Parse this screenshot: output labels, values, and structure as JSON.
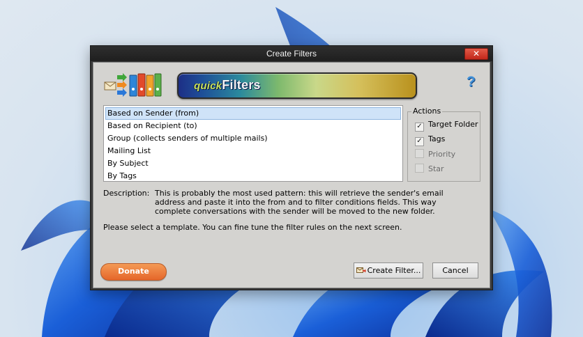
{
  "window": {
    "title": "Create Filters",
    "close_glyph": "✕"
  },
  "header": {
    "logo_icon": "quickfilters-logo-icon",
    "banner_prefix": "quick",
    "banner_word": "Filters",
    "help_glyph": "?"
  },
  "templates": {
    "items": [
      {
        "label": "Based on Sender (from)",
        "selected": true
      },
      {
        "label": "Based on Recipient (to)"
      },
      {
        "label": "Group (collects senders of multiple mails)"
      },
      {
        "label": "Mailing List"
      },
      {
        "label": "By Subject"
      },
      {
        "label": "By Tags"
      }
    ]
  },
  "actions": {
    "legend": "Actions",
    "options": [
      {
        "label": "Target Folder",
        "checked": true,
        "enabled": true
      },
      {
        "label": "Tags",
        "checked": true,
        "enabled": true
      },
      {
        "label": "Priority",
        "checked": false,
        "enabled": false
      },
      {
        "label": "Star",
        "checked": false,
        "enabled": false
      }
    ]
  },
  "description": {
    "label": "Description:",
    "text": "This is probably the most used pattern: this will retrieve the sender's email address and paste it into the from and to filter conditions fields. This way complete conversations with the sender will be moved to the new folder."
  },
  "hint": "Please select a template. You can fine tune the filter rules on the next screen.",
  "buttons": {
    "donate": "Donate",
    "create": "Create Filter...",
    "cancel": "Cancel"
  },
  "colors": {
    "accent": "#e5662a",
    "titlebar": "#1f1f1f",
    "selection": "#cfe3f8"
  }
}
